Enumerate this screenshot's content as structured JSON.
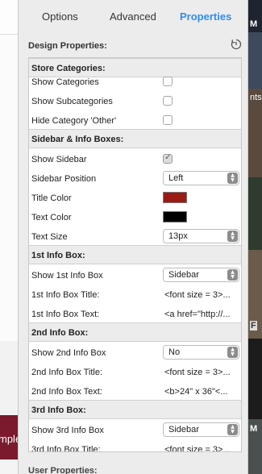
{
  "tabs": [
    {
      "label": "Options",
      "active": false
    },
    {
      "label": "Advanced",
      "active": false
    },
    {
      "label": "Properties",
      "active": true
    }
  ],
  "design": {
    "title": "Design Properties:",
    "reset_icon": "reset-icon"
  },
  "sections": {
    "store": {
      "title": "Store Categories:",
      "show_categories": {
        "label": "Show Categories",
        "checked": false
      },
      "show_subcategories": {
        "label": "Show Subcategories",
        "checked": false
      },
      "hide_other": {
        "label": "Hide Category 'Other'",
        "checked": false
      }
    },
    "sidebar": {
      "title": "Sidebar & Info Boxes:",
      "show_sidebar": {
        "label": "Show Sidebar",
        "checked": true
      },
      "position": {
        "label": "Sidebar Position",
        "value": "Left"
      },
      "title_color": {
        "label": "Title Color",
        "color": "#9b1a14"
      },
      "text_color": {
        "label": "Text Color",
        "color": "#000000"
      },
      "text_size": {
        "label": "Text Size",
        "value": "13px"
      }
    },
    "info1": {
      "title": "1st Info Box:",
      "show": {
        "label": "Show 1st Info Box",
        "value": "Sidebar"
      },
      "box_title": {
        "label": "1st Info Box Title:",
        "value": "<font size = 3>..."
      },
      "box_text": {
        "label": "1st Info Box Text:",
        "value": "<a href=\"http://..."
      }
    },
    "info2": {
      "title": "2nd Info Box:",
      "show": {
        "label": "Show 2nd Info Box",
        "value": "No"
      },
      "box_title": {
        "label": "2nd Info Box Title:",
        "value": "<font size = 3>..."
      },
      "box_text": {
        "label": "2nd Info Box Text:",
        "value": "<b>24\" x 36\"<..."
      }
    },
    "info3": {
      "title": "3rd Info Box:",
      "show": {
        "label": "Show 3rd Info Box",
        "value": "Sidebar"
      },
      "box_title": {
        "label": "3rd Info Box Title:",
        "value": "<font size = 3>..."
      }
    }
  },
  "user_properties": {
    "title": "User Properties:"
  },
  "background": {
    "left_text": "mple",
    "right_texts": [
      "M",
      "nts",
      "F",
      "M"
    ]
  },
  "colors": {
    "accent": "#2f8cf0",
    "panel_bg": "#ececec"
  }
}
